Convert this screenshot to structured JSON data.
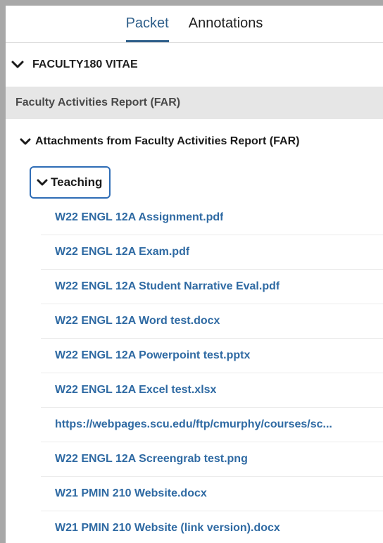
{
  "tabs": [
    {
      "label": "Packet",
      "active": true
    },
    {
      "label": "Annotations",
      "active": false
    }
  ],
  "section": {
    "title": "FACULTY180 VITAE"
  },
  "subheader": {
    "title": "Faculty Activities Report (FAR)"
  },
  "group": {
    "title": "Attachments from Faculty Activities Report (FAR)"
  },
  "folder": {
    "title": "Teaching"
  },
  "files": [
    "W22 ENGL 12A Assignment.pdf",
    "W22 ENGL 12A Exam.pdf",
    "W22 ENGL 12A Student Narrative Eval.pdf",
    "W22 ENGL 12A Word test.docx",
    "W22 ENGL 12A Powerpoint test.pptx",
    "W22 ENGL 12A Excel test.xlsx",
    "https://webpages.scu.edu/ftp/cmurphy/courses/sc...",
    "W22 ENGL 12A Screengrab test.png",
    "W21 PMIN 210 Website.docx",
    "W21 PMIN 210 Website (link version).docx"
  ],
  "colors": {
    "accent": "#2f5f8a",
    "link": "#2f6aa3",
    "focus_border": "#2f6db6",
    "subheader_bg": "#e6e6e6",
    "frame": "#a8a8a8"
  },
  "icons": {
    "collapse": "chevron-down-icon"
  }
}
